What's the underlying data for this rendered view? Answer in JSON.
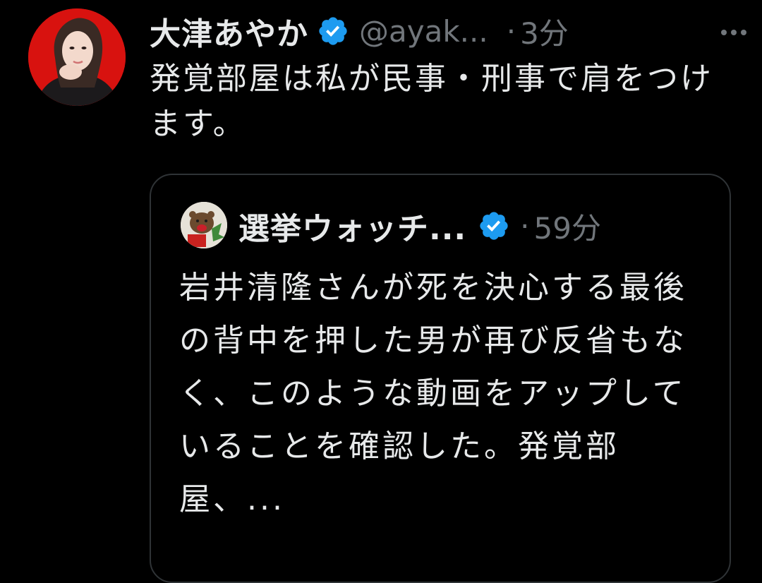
{
  "tweet": {
    "display_name": "大津あやか",
    "handle": "@ayak...",
    "separator": "·",
    "time": "3分",
    "text": "発覚部屋は私が民事・刑事で肩をつけます。"
  },
  "quoted_tweet": {
    "display_name": "選挙ウォッチ...",
    "separator": "·",
    "time": "59分",
    "text": "岩井清隆さんが死を決心する最後の背中を押した男が再び反省もなく、このような動画をアップしていることを確認した。発覚部屋、..."
  },
  "icons": {
    "verified": "verified-badge-icon",
    "more": "more-options-icon"
  },
  "colors": {
    "background": "#000000",
    "primary_text": "#e7e9ea",
    "secondary_text": "#71767b",
    "verified_blue": "#1d9bf0",
    "card_border": "#2f3336"
  }
}
